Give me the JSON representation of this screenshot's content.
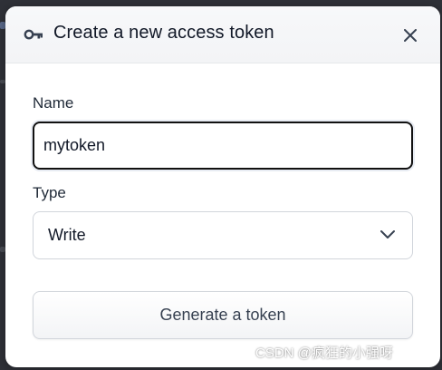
{
  "dialog": {
    "title": "Create a new access token",
    "close_icon": "close-icon",
    "title_icon": "key-icon"
  },
  "form": {
    "name_label": "Name",
    "name_value": "mytoken",
    "type_label": "Type",
    "type_value": "Write",
    "type_icon": "chevron-down-icon",
    "generate_label": "Generate a token"
  },
  "watermark": "CSDN @疯狂的小强呀",
  "colors": {
    "dialog_bg": "#ffffff",
    "header_bg": "#f3f4f6",
    "focus_border": "#111111",
    "text": "#111827"
  }
}
